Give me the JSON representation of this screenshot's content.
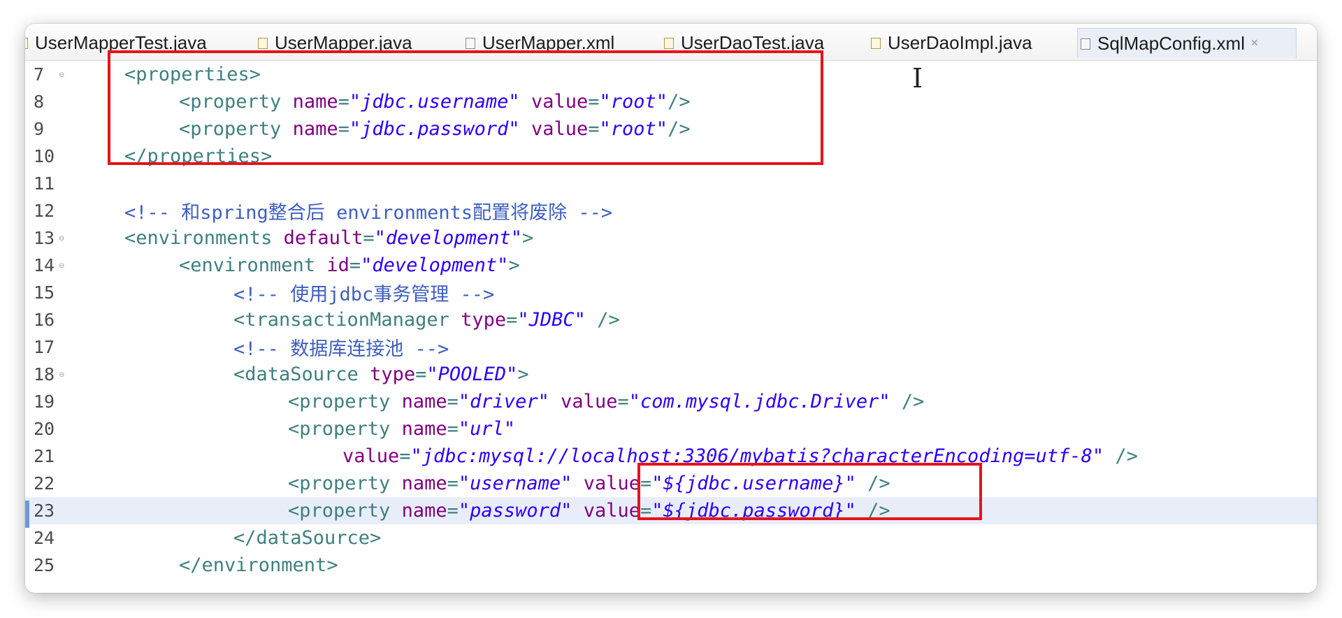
{
  "tabs": [
    {
      "label": "UserMapperTest.java",
      "icon": "java-file-icon",
      "active": false
    },
    {
      "label": "UserMapper.java",
      "icon": "java-file-icon",
      "active": false
    },
    {
      "label": "UserMapper.xml",
      "icon": "xml-file-icon",
      "active": false
    },
    {
      "label": "UserDaoTest.java",
      "icon": "java-file-icon",
      "active": false
    },
    {
      "label": "UserDaoImpl.java",
      "icon": "java-file-icon",
      "active": false
    },
    {
      "label": "SqlMapConfig.xml",
      "icon": "xml-file-icon",
      "active": true
    }
  ],
  "tab_close_glyph": "✕",
  "lines": [
    {
      "num": "7",
      "fold": true,
      "indent": 1,
      "parts": [
        [
          "tag",
          "<properties>"
        ]
      ]
    },
    {
      "num": "8",
      "fold": false,
      "indent": 2,
      "parts": [
        [
          "tag",
          "<property "
        ],
        [
          "attr",
          "name"
        ],
        [
          "tag",
          "="
        ],
        [
          "val",
          "\"jdbc.username\""
        ],
        [
          "tag",
          " "
        ],
        [
          "attr",
          "value"
        ],
        [
          "tag",
          "="
        ],
        [
          "val",
          "\"root\""
        ],
        [
          "tag",
          "/>"
        ]
      ]
    },
    {
      "num": "9",
      "fold": false,
      "indent": 2,
      "parts": [
        [
          "tag",
          "<property "
        ],
        [
          "attr",
          "name"
        ],
        [
          "tag",
          "="
        ],
        [
          "val",
          "\"jdbc.password\""
        ],
        [
          "tag",
          " "
        ],
        [
          "attr",
          "value"
        ],
        [
          "tag",
          "="
        ],
        [
          "val",
          "\"root\""
        ],
        [
          "tag",
          "/>"
        ]
      ]
    },
    {
      "num": "10",
      "fold": false,
      "indent": 1,
      "parts": [
        [
          "tag",
          "</properties>"
        ]
      ]
    },
    {
      "num": "11",
      "fold": false,
      "indent": 0,
      "parts": []
    },
    {
      "num": "12",
      "fold": false,
      "indent": 1,
      "parts": [
        [
          "cmt",
          "<!-- 和spring整合后 environments配置将废除 -->"
        ]
      ]
    },
    {
      "num": "13",
      "fold": true,
      "indent": 1,
      "parts": [
        [
          "tag",
          "<environments "
        ],
        [
          "attr",
          "default"
        ],
        [
          "tag",
          "="
        ],
        [
          "val",
          "\"development\""
        ],
        [
          "tag",
          ">"
        ]
      ]
    },
    {
      "num": "14",
      "fold": true,
      "indent": 2,
      "parts": [
        [
          "tag",
          "<environment "
        ],
        [
          "attr",
          "id"
        ],
        [
          "tag",
          "="
        ],
        [
          "val",
          "\"development\""
        ],
        [
          "tag",
          ">"
        ]
      ]
    },
    {
      "num": "15",
      "fold": false,
      "indent": 3,
      "parts": [
        [
          "cmt",
          "<!-- 使用jdbc事务管理 -->"
        ]
      ]
    },
    {
      "num": "16",
      "fold": false,
      "indent": 3,
      "parts": [
        [
          "tag",
          "<transactionManager "
        ],
        [
          "attr",
          "type"
        ],
        [
          "tag",
          "="
        ],
        [
          "val",
          "\"JDBC\""
        ],
        [
          "tag",
          " />"
        ]
      ]
    },
    {
      "num": "17",
      "fold": false,
      "indent": 3,
      "parts": [
        [
          "cmt",
          "<!-- 数据库连接池 -->"
        ]
      ]
    },
    {
      "num": "18",
      "fold": true,
      "indent": 3,
      "parts": [
        [
          "tag",
          "<dataSource "
        ],
        [
          "attr",
          "type"
        ],
        [
          "tag",
          "="
        ],
        [
          "val",
          "\"POOLED\""
        ],
        [
          "tag",
          ">"
        ]
      ]
    },
    {
      "num": "19",
      "fold": false,
      "indent": 4,
      "parts": [
        [
          "tag",
          "<property "
        ],
        [
          "attr",
          "name"
        ],
        [
          "tag",
          "="
        ],
        [
          "val",
          "\"driver\""
        ],
        [
          "tag",
          " "
        ],
        [
          "attr",
          "value"
        ],
        [
          "tag",
          "="
        ],
        [
          "val",
          "\"com.mysql.jdbc.Driver\""
        ],
        [
          "tag",
          " />"
        ]
      ]
    },
    {
      "num": "20",
      "fold": false,
      "indent": 4,
      "parts": [
        [
          "tag",
          "<property "
        ],
        [
          "attr",
          "name"
        ],
        [
          "tag",
          "="
        ],
        [
          "val",
          "\"url\""
        ]
      ]
    },
    {
      "num": "21",
      "fold": false,
      "indent": 5,
      "parts": [
        [
          "attr",
          "value"
        ],
        [
          "tag",
          "="
        ],
        [
          "val",
          "\"jdbc:mysql://localhost:3306/mybatis?characterEncoding=utf-8\""
        ],
        [
          "tag",
          " />"
        ]
      ]
    },
    {
      "num": "22",
      "fold": false,
      "indent": 4,
      "parts": [
        [
          "tag",
          "<property "
        ],
        [
          "attr",
          "name"
        ],
        [
          "tag",
          "="
        ],
        [
          "val",
          "\"username\""
        ],
        [
          "tag",
          " "
        ],
        [
          "attr",
          "value"
        ],
        [
          "tag",
          "="
        ],
        [
          "val",
          "\"${jdbc.username}\""
        ],
        [
          "tag",
          " />"
        ]
      ]
    },
    {
      "num": "23",
      "fold": false,
      "indent": 4,
      "current": true,
      "parts": [
        [
          "tag",
          "<property "
        ],
        [
          "attr",
          "name"
        ],
        [
          "tag",
          "="
        ],
        [
          "val",
          "\"password\""
        ],
        [
          "tag",
          " "
        ],
        [
          "attr",
          "value"
        ],
        [
          "tag",
          "="
        ],
        [
          "val",
          "\"${jdbc.password}\""
        ],
        [
          "tag",
          " />"
        ]
      ]
    },
    {
      "num": "24",
      "fold": false,
      "indent": 3,
      "parts": [
        [
          "tag",
          "</dataSource>"
        ]
      ]
    },
    {
      "num": "25",
      "fold": false,
      "indent": 2,
      "parts": [
        [
          "tag",
          "</environment>"
        ]
      ]
    }
  ],
  "colors": {
    "tag": "#3f7f7f",
    "attribute": "#7f007f",
    "value": "#2a00ff",
    "comment": "#3f5fbf",
    "highlight_box": "#e8131b",
    "current_line": "#e8eef9"
  },
  "annotations": [
    {
      "name": "properties-highlight-box"
    },
    {
      "name": "placeholder-values-highlight-box"
    }
  ],
  "cursor": {
    "icon": "text-cursor-icon",
    "glyph": "I"
  }
}
